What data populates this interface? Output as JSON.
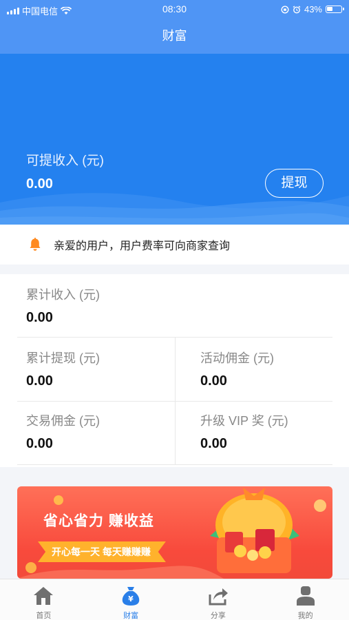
{
  "status_bar": {
    "carrier": "中国电信",
    "time": "08:30",
    "battery": "43%",
    "battery_level": 0.43
  },
  "nav": {
    "title": "财富"
  },
  "hero": {
    "withdrawable_label": "可提收入 (元)",
    "withdrawable_value": "0.00",
    "withdraw_button": "提现"
  },
  "notice": {
    "text": "亲爱的用户，用户费率可向商家查询",
    "icon": "bell-icon"
  },
  "stats": {
    "total_income": {
      "label": "累计收入 (元)",
      "value": "0.00"
    },
    "total_withdrawn": {
      "label": "累计提现 (元)",
      "value": "0.00"
    },
    "activity_commission": {
      "label": "活动佣金 (元)",
      "value": "0.00"
    },
    "trade_commission": {
      "label": "交易佣金 (元)",
      "value": "0.00"
    },
    "vip_bonus": {
      "label": "升级 VIP 奖 (元)",
      "value": "0.00"
    }
  },
  "banner": {
    "title": "省心省力 赚收益",
    "slogan": "开心每一天 每天赚赚赚"
  },
  "tabbar": {
    "items": [
      {
        "label": "首页",
        "icon": "home-icon",
        "active": false
      },
      {
        "label": "财富",
        "icon": "money-bag-icon",
        "active": true
      },
      {
        "label": "分享",
        "icon": "share-icon",
        "active": false
      },
      {
        "label": "我的",
        "icon": "user-icon",
        "active": false
      }
    ]
  },
  "colors": {
    "brand_blue": "#2481ef",
    "nav_blue": "#4f95f5",
    "bell_orange": "#ff8a1f",
    "banner_red": "#f84a3c",
    "ribbon_gold": "#ffb22c",
    "tab_active": "#2a7fe8",
    "tab_inactive": "#6f6f6f"
  }
}
